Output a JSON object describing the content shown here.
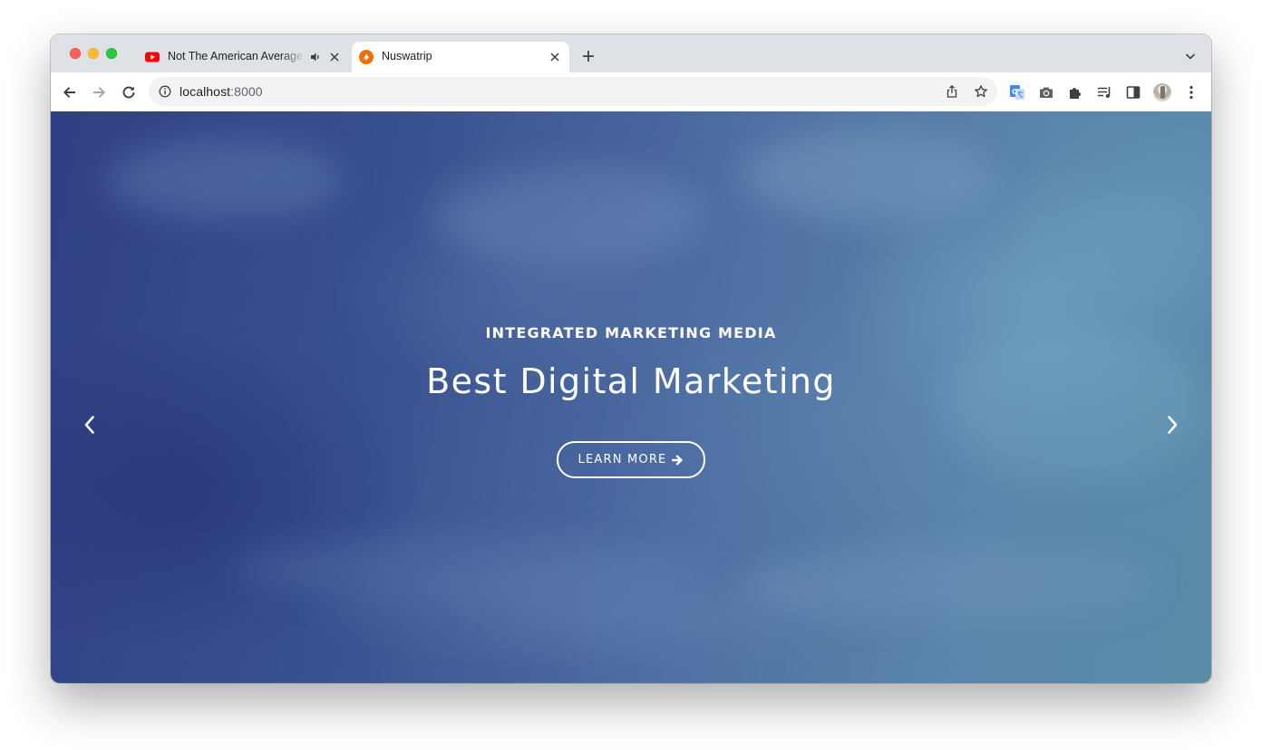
{
  "browser": {
    "tabs": [
      {
        "title": "Not The American Average",
        "favicon": "youtube-icon",
        "audio": "speaker-icon",
        "active": false
      },
      {
        "title": "Nuswatrip",
        "favicon": "nuswatrip-icon",
        "active": true
      }
    ],
    "address": {
      "host": "localhost",
      "port": ":8000"
    },
    "colors": {
      "tabstrip": "#dee1e6",
      "youtube_red": "#ff0000",
      "favicon_orange": "#e8710a"
    }
  },
  "hero": {
    "kicker": "INTEGRATED MARKETING MEDIA",
    "headline": "Best Digital Marketing",
    "cta_label": "LEARN MORE",
    "cta_icon": "arrow-right-icon",
    "prev_icon": "chevron-left-icon",
    "next_icon": "chevron-right-icon"
  }
}
